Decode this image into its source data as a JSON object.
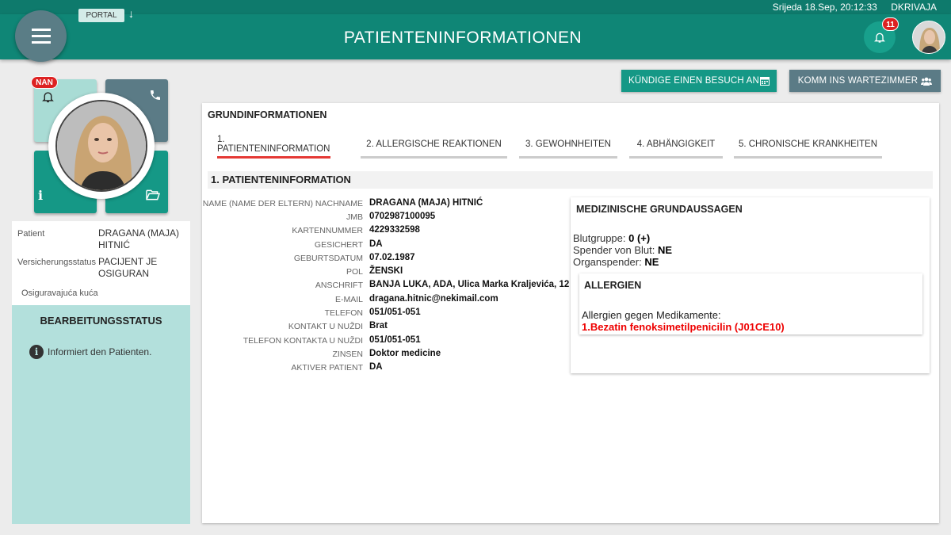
{
  "header": {
    "title": "PATIENTENINFORMATIONEN",
    "datetime": "Srijeda 18.Sep, 20:12:33",
    "username": "DKRIVAJA",
    "portal_label": "PORTAL",
    "portal_arrow": "↓",
    "notifications_count": "11",
    "icons": [
      "menu-icon",
      "bell-icon",
      "user-avatar"
    ]
  },
  "tiles": {
    "badge": "NAN",
    "icons": [
      "bell-icon",
      "phone-icon",
      "info-icon",
      "folder-open-icon"
    ],
    "colors": {
      "light": "#a9dcd5",
      "slate": "#5b7b86",
      "teal": "#159886"
    }
  },
  "patient_summary": {
    "patient_label": "Patient",
    "patient_value": "DRAGANA (MAJA) HITNIĆ",
    "insurance_label": "Versicherungsstatus",
    "insurance_value": "PACIJENT JE OSIGURAN",
    "insurer_label": "Osiguravajuća kuća",
    "insurer_value": ""
  },
  "processing_status": {
    "title": "BEARBEITUNGSSTATUS",
    "message": "Informiert den Patienten.",
    "icon": "info-circle-icon"
  },
  "actions": {
    "schedule_visit": "KÜNDIGE EINEN BESUCH AN",
    "schedule_icon": "calendar-icon",
    "waiting_room": "KOMM INS WARTEZIMMER",
    "waiting_icon": "users-icon"
  },
  "card": {
    "title": "GRUNDINFORMATIONEN",
    "tabs": [
      {
        "label": "1. PATIENTENINFORMATION",
        "active": true
      },
      {
        "label": "2. ALLERGISCHE REAKTIONEN",
        "active": false
      },
      {
        "label": "3. GEWOHNHEITEN",
        "active": false
      },
      {
        "label": "4. ABHÄNGIGKEIT",
        "active": false
      },
      {
        "label": "5. CHRONISCHE KRANKHEITEN",
        "active": false
      }
    ],
    "section_title": "1. PATIENTENINFORMATION",
    "fields": [
      {
        "label": "NAME (NAME DER ELTERN) NACHNAME",
        "value": "DRAGANA (MAJA) HITNIĆ"
      },
      {
        "label": "JMB",
        "value": "0702987100095"
      },
      {
        "label": "KARTENNUMMER",
        "value": "4229332598"
      },
      {
        "label": "GESICHERT",
        "value": "DA"
      },
      {
        "label": "GEBURTSDATUM",
        "value": "07.02.1987"
      },
      {
        "label": "POL",
        "value": "ŽENSKI"
      },
      {
        "label": "ANSCHRIFT",
        "value": "BANJA LUKA, ADA, Ulica Marka Kraljevića, 12"
      },
      {
        "label": "E-MAIL",
        "value": "dragana.hitnic@nekimail.com"
      },
      {
        "label": "TELEFON",
        "value": "051/051-051"
      },
      {
        "label": "KONTAKT U NUŽDI",
        "value": "Brat"
      },
      {
        "label": "TELEFON KONTAKTA U NUŽDI",
        "value": "051/051-051"
      },
      {
        "label": "ZINSEN",
        "value": "Doktor medicine"
      },
      {
        "label": "AKTIVER PATIENT",
        "value": "DA"
      }
    ],
    "medical": {
      "title": "MEDIZINISCHE GRUNDAUSSAGEN",
      "blood_group_label": "Blutgruppe:",
      "blood_group_value": "0 (+)",
      "blood_donor_label": "Spender von Blut:",
      "blood_donor_value": "NE",
      "organ_donor_label": "Organspender:",
      "organ_donor_value": "NE",
      "allergies": {
        "title": "ALLERGIEN",
        "subtitle": "Allergien gegen Medikamente:",
        "item": "1.Bezatin fenoksimetilpenicilin (J01CE10)"
      }
    }
  }
}
